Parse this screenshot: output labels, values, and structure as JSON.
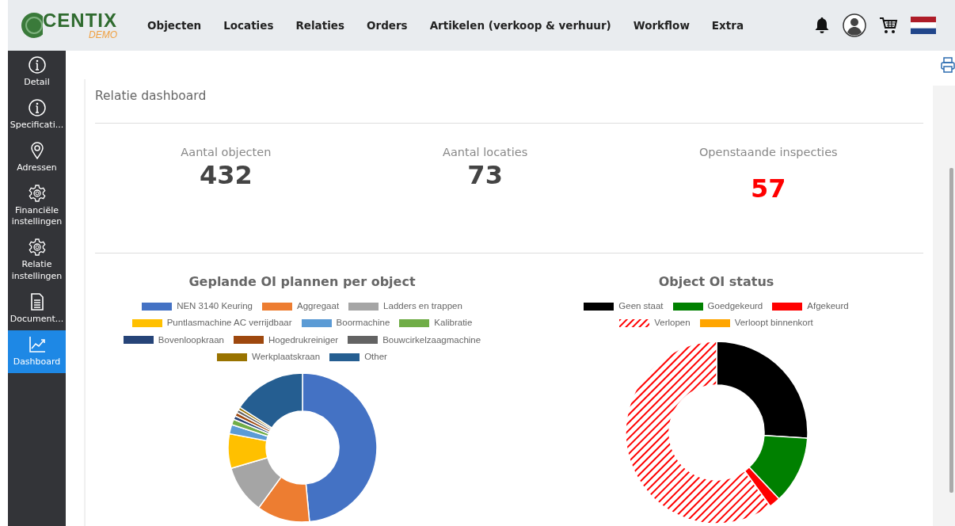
{
  "logo": {
    "name": "CENTIX",
    "tag": "DEMO"
  },
  "nav": [
    {
      "label": "Objecten"
    },
    {
      "label": "Locaties"
    },
    {
      "label": "Relaties"
    },
    {
      "label": "Orders"
    },
    {
      "label": "Artikelen (verkoop & verhuur)"
    },
    {
      "label": "Workflow"
    },
    {
      "label": "Extra"
    }
  ],
  "sidebar": {
    "items": [
      {
        "label": "Detail",
        "selected": false
      },
      {
        "label": "Specificati...",
        "selected": false
      },
      {
        "label": "Adressen",
        "selected": false
      },
      {
        "label": "Financiële instellingen",
        "selected": false
      },
      {
        "label": "Relatie instellingen",
        "selected": false
      },
      {
        "label": "Document...",
        "selected": false
      },
      {
        "label": "Dashboard",
        "selected": true
      }
    ]
  },
  "page_title": "Relatie dashboard",
  "stats": [
    {
      "label": "Aantal objecten",
      "value": "432",
      "alert": false
    },
    {
      "label": "Aantal locaties",
      "value": "73",
      "alert": false
    },
    {
      "label": "Openstaande inspecties",
      "value": "57",
      "alert": true
    }
  ],
  "charts": [
    {
      "title": "Geplande OI plannen per object",
      "legend": [
        {
          "label": "NEN 3140 Keuring",
          "color": "#4472c4",
          "kind": "solid"
        },
        {
          "label": "Aggregaat",
          "color": "#ed7d31",
          "kind": "solid"
        },
        {
          "label": "Ladders en trappen",
          "color": "#a5a5a5",
          "kind": "solid"
        },
        {
          "label": "Puntlasmachine AC verrijdbaar",
          "color": "#ffc000",
          "kind": "solid"
        },
        {
          "label": "Boormachine",
          "color": "#5b9bd5",
          "kind": "solid"
        },
        {
          "label": "Kalibratie",
          "color": "#70ad47",
          "kind": "solid"
        },
        {
          "label": "Bovenloopkraan",
          "color": "#264478",
          "kind": "solid"
        },
        {
          "label": "Hogedrukreiniger",
          "color": "#9e480e",
          "kind": "solid"
        },
        {
          "label": "Bouwcirkelzaagmachine",
          "color": "#636363",
          "kind": "solid"
        },
        {
          "label": "Werkplaatskraan",
          "color": "#997300",
          "kind": "solid"
        },
        {
          "label": "Other",
          "color": "#255e91",
          "kind": "solid"
        }
      ]
    },
    {
      "title": "Object OI status",
      "legend": [
        {
          "label": "Geen staat",
          "color": "#000000",
          "kind": "solid"
        },
        {
          "label": "Goedgekeurd",
          "color": "#008000",
          "kind": "solid"
        },
        {
          "label": "Afgekeurd",
          "color": "#ff0000",
          "kind": "solid"
        },
        {
          "label": "Verlopen",
          "color": "#ff0000",
          "kind": "hatched"
        },
        {
          "label": "Verloopt binnenkort",
          "color": "#ffa500",
          "kind": "solid"
        }
      ]
    }
  ]
}
